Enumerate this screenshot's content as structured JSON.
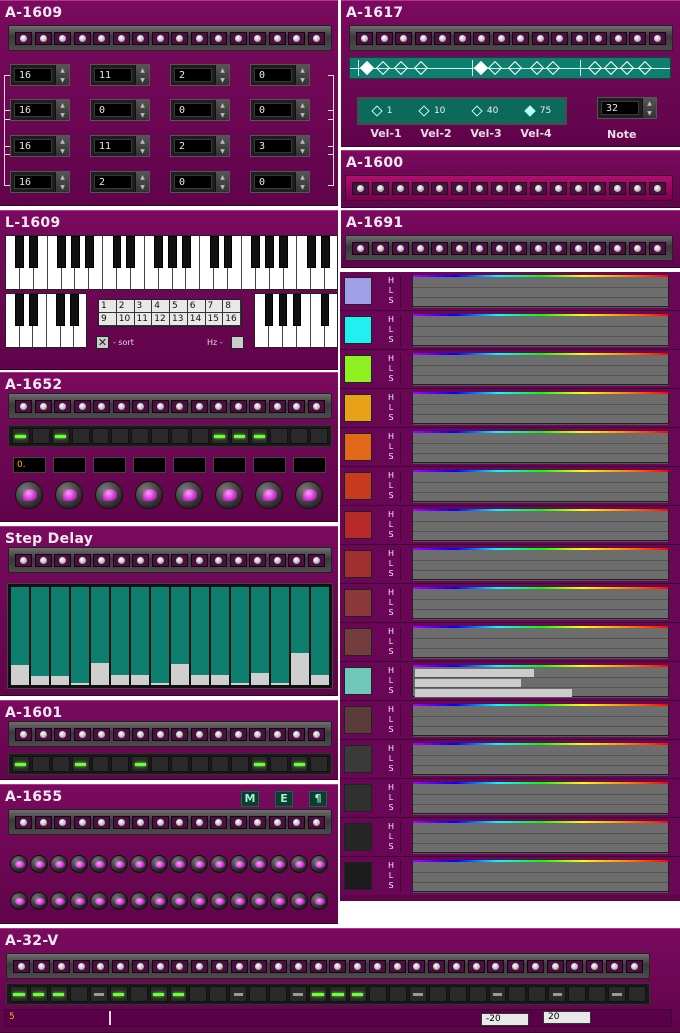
{
  "panels": {
    "a1609": {
      "title": "A-1609"
    },
    "a1617": {
      "title": "A-1617",
      "vel_labels": [
        "Vel-1",
        "Vel-2",
        "Vel-3",
        "Vel-4"
      ],
      "vel_values": [
        "1",
        "10",
        "40",
        "75"
      ],
      "note_label": "Note",
      "note_value": "32"
    },
    "a1600": {
      "title": "A-1600"
    },
    "l1609": {
      "title": "L-1609",
      "grid": [
        "1",
        "2",
        "3",
        "4",
        "5",
        "6",
        "7",
        "8",
        "9",
        "10",
        "11",
        "12",
        "13",
        "14",
        "15",
        "16"
      ],
      "sort_label": "- sort",
      "hz_label": "Hz -"
    },
    "a1691": {
      "title": "A-1691"
    },
    "a1652": {
      "title": "A-1652",
      "first_field": "0."
    },
    "step_delay": {
      "title": "Step Delay"
    },
    "a1601": {
      "title": "A-1601"
    },
    "a1655": {
      "title": "A-1655",
      "buttons": [
        "M",
        "E",
        "¶"
      ]
    },
    "a32v": {
      "title": "A-32-V",
      "pos_label": "5",
      "left_value": "-20",
      "right_value": "20"
    }
  },
  "matrix": [
    [
      "16",
      "11",
      "2",
      "0"
    ],
    [
      "16",
      "0",
      "0",
      "0"
    ],
    [
      "16",
      "11",
      "2",
      "3"
    ],
    [
      "16",
      "2",
      "0",
      "0"
    ]
  ],
  "colors": {
    "panel": "#6a0656",
    "led_on": "#6cff3a",
    "teal": "#0e7e6e"
  },
  "step_delay_levels": [
    0.2,
    0.09,
    0.09,
    0.02,
    0.22,
    0.1,
    0.1,
    0.02,
    0.21,
    0.1,
    0.1,
    0.02,
    0.12,
    0.02,
    0.33,
    0.1
  ],
  "a1691_rows": [
    {
      "color": "#a0a0e8",
      "h": 0,
      "l": 0,
      "s": 0
    },
    {
      "color": "#20f0f0",
      "h": 0,
      "l": 0,
      "s": 0
    },
    {
      "color": "#8ef020",
      "h": 0,
      "l": 0,
      "s": 0
    },
    {
      "color": "#e8a018",
      "h": 0,
      "l": 0,
      "s": 0
    },
    {
      "color": "#e06818",
      "h": 0,
      "l": 0,
      "s": 0
    },
    {
      "color": "#c83a1e",
      "h": 0,
      "l": 0,
      "s": 0
    },
    {
      "color": "#b82a2a",
      "h": 0,
      "l": 0,
      "s": 0
    },
    {
      "color": "#a03030",
      "h": 0,
      "l": 0,
      "s": 0
    },
    {
      "color": "#8c3838",
      "h": 0,
      "l": 0,
      "s": 0
    },
    {
      "color": "#743c3c",
      "h": 0,
      "l": 0,
      "s": 0
    },
    {
      "color": "#70c8b8",
      "h": 0.47,
      "l": 0.42,
      "s": 0.62
    },
    {
      "color": "#5a3a3a",
      "h": 0,
      "l": 0,
      "s": 0
    },
    {
      "color": "#3a3a3a",
      "h": 0,
      "l": 0,
      "s": 0
    },
    {
      "color": "#303030",
      "h": 0,
      "l": 0,
      "s": 0
    },
    {
      "color": "#262626",
      "h": 0,
      "l": 0,
      "s": 0
    },
    {
      "color": "#1c1c1c",
      "h": 0,
      "l": 0,
      "s": 0
    }
  ],
  "hls_letters": [
    "H",
    "L",
    "S"
  ],
  "seq_a1652": [
    1,
    0,
    1,
    0,
    0,
    0,
    0,
    0,
    0,
    0,
    1,
    1,
    1,
    0,
    0,
    0
  ],
  "seq_a1601": [
    1,
    0,
    0,
    1,
    0,
    0,
    1,
    0,
    0,
    0,
    0,
    0,
    1,
    0,
    1,
    0
  ],
  "seq_a32v": [
    1,
    1,
    1,
    0,
    2,
    1,
    0,
    1,
    1,
    0,
    0,
    2,
    0,
    0,
    2,
    1,
    1,
    1,
    0,
    0,
    2,
    0,
    0,
    0,
    2,
    0,
    0,
    2,
    0,
    0,
    2,
    0
  ]
}
